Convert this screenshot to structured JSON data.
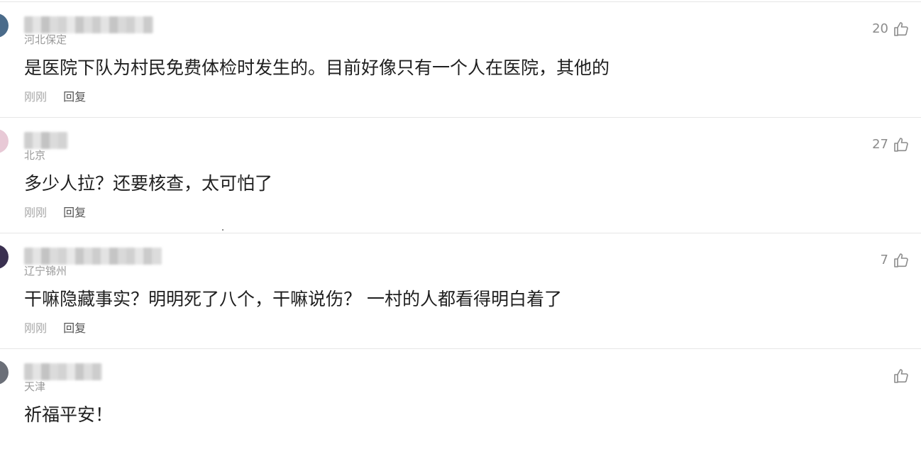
{
  "comments": [
    {
      "location": "河北保定",
      "content": "是医院下队为村民免费体检时发生的。目前好像只有一个人在医院，其他的",
      "time": "刚刚",
      "reply_label": "回复",
      "likes": "20",
      "avatar_color": "#4a6b8a"
    },
    {
      "location": "北京",
      "content": "多少人拉？还要核查，太可怕了",
      "time": "刚刚",
      "reply_label": "回复",
      "likes": "27",
      "avatar_color": "#e8c9d6"
    },
    {
      "location": "辽宁锦州",
      "content": "干嘛隐藏事实？明明死了八个，干嘛说伤？ 一村的人都看得明白着了",
      "time": "刚刚",
      "reply_label": "回复",
      "likes": "7",
      "avatar_color": "#3a3050"
    },
    {
      "location": "天津",
      "content": "祈福平安！",
      "time": "",
      "reply_label": "",
      "likes": "",
      "avatar_color": "#6b6f78"
    }
  ],
  "icons": {
    "like": "thumbs-up-icon"
  },
  "colors": {
    "text": "#1f1f1f",
    "muted": "#9a9a9a",
    "divider": "#e6e6e6",
    "like": "#8c8c8c"
  }
}
